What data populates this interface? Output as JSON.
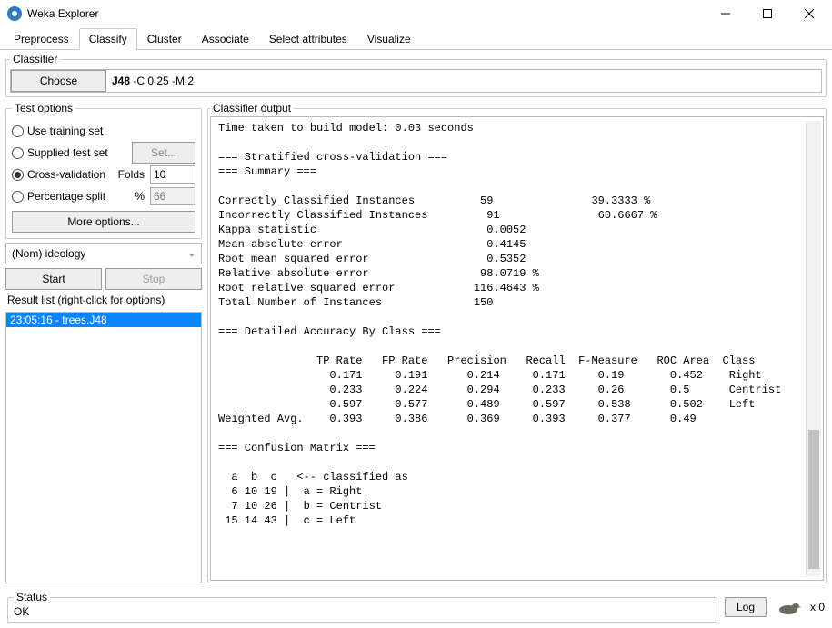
{
  "window": {
    "title": "Weka Explorer"
  },
  "tabs": [
    "Preprocess",
    "Classify",
    "Cluster",
    "Associate",
    "Select attributes",
    "Visualize"
  ],
  "active_tab": 1,
  "classifier": {
    "legend": "Classifier",
    "choose": "Choose",
    "name": "J48",
    "args": " -C 0.25 -M 2"
  },
  "test_options": {
    "legend": "Test options",
    "training": "Use training set",
    "supplied": "Supplied test set",
    "set_btn": "Set...",
    "cross": "Cross-validation",
    "folds_label": "Folds",
    "folds_value": "10",
    "percent": "Percentage split",
    "percent_label": "%",
    "percent_value": "66",
    "more": "More options...",
    "selected": "cross"
  },
  "attr_select": "(Nom) ideology",
  "start": "Start",
  "stop": "Stop",
  "result_list_label": "Result list (right-click for options)",
  "result_item": "23:05:16 - trees.J48",
  "output": {
    "legend": "Classifier output",
    "text": "Time taken to build model: 0.03 seconds\n\n=== Stratified cross-validation ===\n=== Summary ===\n\nCorrectly Classified Instances          59               39.3333 %\nIncorrectly Classified Instances         91               60.6667 %\nKappa statistic                          0.0052\nMean absolute error                      0.4145\nRoot mean squared error                  0.5352\nRelative absolute error                 98.0719 %\nRoot relative squared error            116.4643 %\nTotal Number of Instances              150     \n\n=== Detailed Accuracy By Class ===\n\n               TP Rate   FP Rate   Precision   Recall  F-Measure   ROC Area  Class\n                 0.171     0.191      0.214     0.171     0.19       0.452    Right\n                 0.233     0.224      0.294     0.233     0.26       0.5      Centrist\n                 0.597     0.577      0.489     0.597     0.538      0.502    Left\nWeighted Avg.    0.393     0.386      0.369     0.393     0.377      0.49 \n\n=== Confusion Matrix ===\n\n  a  b  c   <-- classified as\n  6 10 19 |  a = Right\n  7 10 26 |  b = Centrist\n 15 14 43 |  c = Left\n"
  },
  "status": {
    "legend": "Status",
    "text": "OK",
    "log": "Log",
    "count": "x 0"
  }
}
